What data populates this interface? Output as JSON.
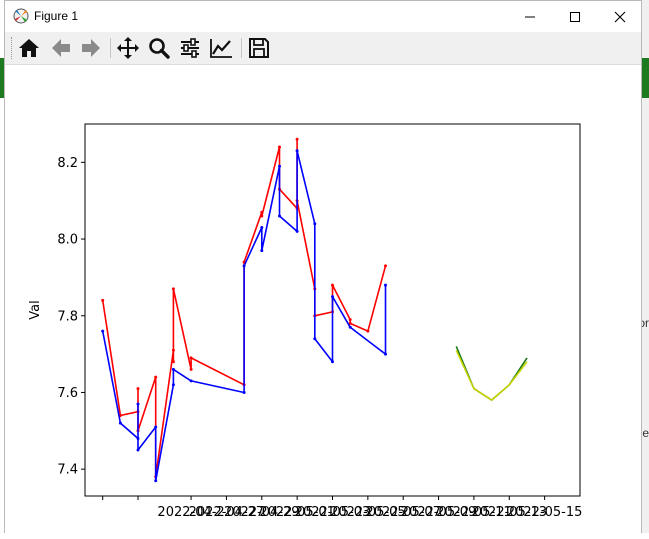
{
  "window": {
    "title": "Figure 1"
  },
  "edge_fragments": [
    "or",
    "e"
  ],
  "toolbar": {
    "icons": [
      "home-icon",
      "back-arrow-icon",
      "forward-arrow-icon",
      "pan-move-icon",
      "zoom-icon",
      "configure-subplots-icon",
      "edit-axis-icon",
      "save-icon"
    ]
  },
  "chart_data": {
    "type": "line",
    "ylabel": "Val",
    "xlabel": "",
    "ylim": [
      7.33,
      8.3
    ],
    "yticks": [
      7.4,
      7.6,
      7.8,
      8.0,
      8.2
    ],
    "ytick_labels": [
      "7.4",
      "7.6",
      "7.8",
      "8.0",
      "8.2"
    ],
    "xlim": [
      "2022-04-19",
      "2022-05-17"
    ],
    "xticks": [
      "2022-04-20",
      "2022-04-22",
      "2022-04-25",
      "2022-04-27",
      "2022-04-29",
      "2022-05-01",
      "2022-05-03",
      "2022-05-05",
      "2022-05-07",
      "2022-05-09",
      "2022-05-11",
      "2022-05-13",
      "2022-05-15"
    ],
    "xtick_labels": [
      "2022-04-2",
      "2022-04-27",
      "2022-04-29",
      "2022-05-01",
      "2022-05-03",
      "2022-05-05",
      "2022-05-07",
      "2022-05-09",
      "2022-05-11",
      "2022-05-13",
      "2022-05-15"
    ],
    "grid": false,
    "series": [
      {
        "color": "#ff0000",
        "x": [
          "2022-04-20",
          "2022-04-21",
          "2022-04-22",
          "2022-04-22",
          "2022-04-22",
          "2022-04-23",
          "2022-04-23",
          "2022-04-24",
          "2022-04-24",
          "2022-04-24",
          "2022-04-25",
          "2022-04-25",
          "2022-04-28",
          "2022-04-28",
          "2022-04-29",
          "2022-04-29",
          "2022-04-30",
          "2022-04-30",
          "2022-04-31",
          "2022-05-01",
          "2022-05-01",
          "2022-05-02",
          "2022-05-02",
          "2022-05-03",
          "2022-05-03",
          "2022-05-04",
          "2022-05-04",
          "2022-05-05",
          "2022-05-06"
        ],
        "y": [
          7.84,
          7.54,
          7.55,
          7.61,
          7.5,
          7.64,
          7.38,
          7.71,
          7.68,
          7.87,
          7.66,
          7.69,
          7.62,
          7.94,
          8.07,
          8.06,
          8.24,
          8.13,
          8.08,
          8.26,
          8.1,
          7.87,
          7.8,
          7.81,
          7.88,
          7.79,
          7.78,
          7.76,
          7.93
        ],
        "values": [
          7.84,
          7.54,
          7.55,
          7.61,
          7.5,
          7.64,
          7.38,
          7.71,
          7.68,
          7.87,
          7.66,
          7.69,
          7.62,
          7.94,
          8.07,
          8.06,
          8.24,
          8.13,
          8.08,
          8.26,
          8.1,
          7.87,
          7.8,
          7.81,
          7.88,
          7.79,
          7.78,
          7.76,
          7.93
        ]
      },
      {
        "color": "#0000ff",
        "x": [
          "2022-04-20",
          "2022-04-21",
          "2022-04-22",
          "2022-04-22",
          "2022-04-22",
          "2022-04-23",
          "2022-04-23",
          "2022-04-24",
          "2022-04-24",
          "2022-04-25",
          "2022-04-28",
          "2022-04-28",
          "2022-04-29",
          "2022-04-29",
          "2022-04-30",
          "2022-04-30",
          "2022-05-01",
          "2022-05-01",
          "2022-05-02",
          "2022-05-02",
          "2022-05-03",
          "2022-05-03",
          "2022-05-04",
          "2022-05-06",
          "2022-05-06"
        ],
        "y": [
          7.76,
          7.52,
          7.48,
          7.57,
          7.45,
          7.51,
          7.37,
          7.62,
          7.66,
          7.63,
          7.6,
          7.93,
          8.03,
          7.97,
          8.19,
          8.06,
          8.02,
          8.23,
          8.04,
          7.74,
          7.68,
          7.85,
          7.77,
          7.7,
          7.88
        ],
        "values": [
          7.76,
          7.52,
          7.48,
          7.57,
          7.45,
          7.51,
          7.37,
          7.62,
          7.66,
          7.63,
          7.6,
          7.93,
          8.03,
          7.97,
          8.19,
          8.06,
          8.02,
          8.23,
          8.04,
          7.74,
          7.68,
          7.85,
          7.77,
          7.7,
          7.88
        ]
      },
      {
        "color": "#1a7a1a",
        "x": [
          "2022-05-10",
          "2022-05-11",
          "2022-05-12",
          "2022-05-13",
          "2022-05-14"
        ],
        "y": [
          7.72,
          7.61,
          7.58,
          7.62,
          7.69
        ],
        "values": [
          7.72,
          7.61,
          7.58,
          7.62,
          7.69
        ]
      },
      {
        "color": "#c8d400",
        "x": [
          "2022-05-10",
          "2022-05-11",
          "2022-05-12",
          "2022-05-13",
          "2022-05-14"
        ],
        "y": [
          7.71,
          7.61,
          7.58,
          7.62,
          7.68
        ],
        "values": [
          7.71,
          7.61,
          7.58,
          7.62,
          7.68
        ]
      }
    ]
  }
}
